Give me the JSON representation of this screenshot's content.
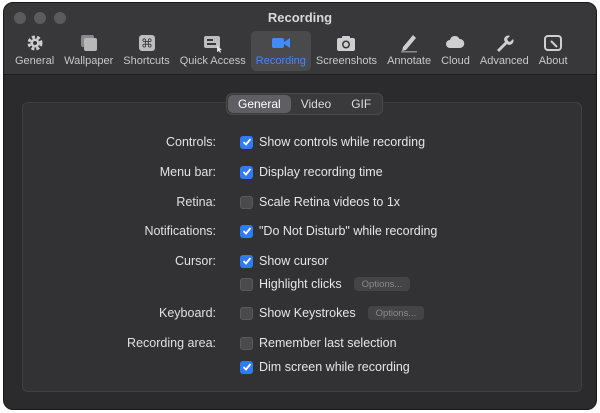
{
  "window": {
    "title": "Recording"
  },
  "toolbar": [
    {
      "label": "General",
      "icon": "gear-icon",
      "active": false
    },
    {
      "label": "Wallpaper",
      "icon": "wallpaper-icon",
      "active": false
    },
    {
      "label": "Shortcuts",
      "icon": "command-key-icon",
      "active": false
    },
    {
      "label": "Quick Access",
      "icon": "quick-access-icon",
      "active": false
    },
    {
      "label": "Recording",
      "icon": "video-camera-icon",
      "active": true
    },
    {
      "label": "Screenshots",
      "icon": "camera-icon",
      "active": false
    },
    {
      "label": "Annotate",
      "icon": "pencil-icon",
      "active": false
    },
    {
      "label": "Cloud",
      "icon": "cloud-icon",
      "active": false
    },
    {
      "label": "Advanced",
      "icon": "wrench-icon",
      "active": false
    },
    {
      "label": "About",
      "icon": "about-icon",
      "active": false
    }
  ],
  "tabs": [
    {
      "label": "General",
      "active": true
    },
    {
      "label": "Video",
      "active": false
    },
    {
      "label": "GIF",
      "active": false
    }
  ],
  "settings": {
    "controls": {
      "label": "Controls:",
      "text": "Show controls while recording",
      "checked": true
    },
    "menu_bar": {
      "label": "Menu bar:",
      "text": "Display recording time",
      "checked": true
    },
    "retina": {
      "label": "Retina:",
      "text": "Scale Retina videos to 1x",
      "checked": false
    },
    "notifications": {
      "label": "Notifications:",
      "text": "\"Do Not Disturb\" while recording",
      "checked": true
    },
    "cursor": {
      "label": "Cursor:",
      "text": "Show cursor",
      "checked": true
    },
    "highlight_clicks": {
      "text": "Highlight clicks",
      "checked": false,
      "button": "Options..."
    },
    "keyboard": {
      "label": "Keyboard:",
      "text": "Show Keystrokes",
      "checked": false,
      "button": "Options..."
    },
    "recording_area": {
      "label": "Recording area:",
      "text": "Remember last selection",
      "checked": false
    },
    "dim_screen": {
      "text": "Dim screen while recording",
      "checked": true
    }
  },
  "colors": {
    "accent": "#2f7bf6",
    "active_tab_text": "#3d8bff",
    "window_bg": "#2b2b2d"
  }
}
